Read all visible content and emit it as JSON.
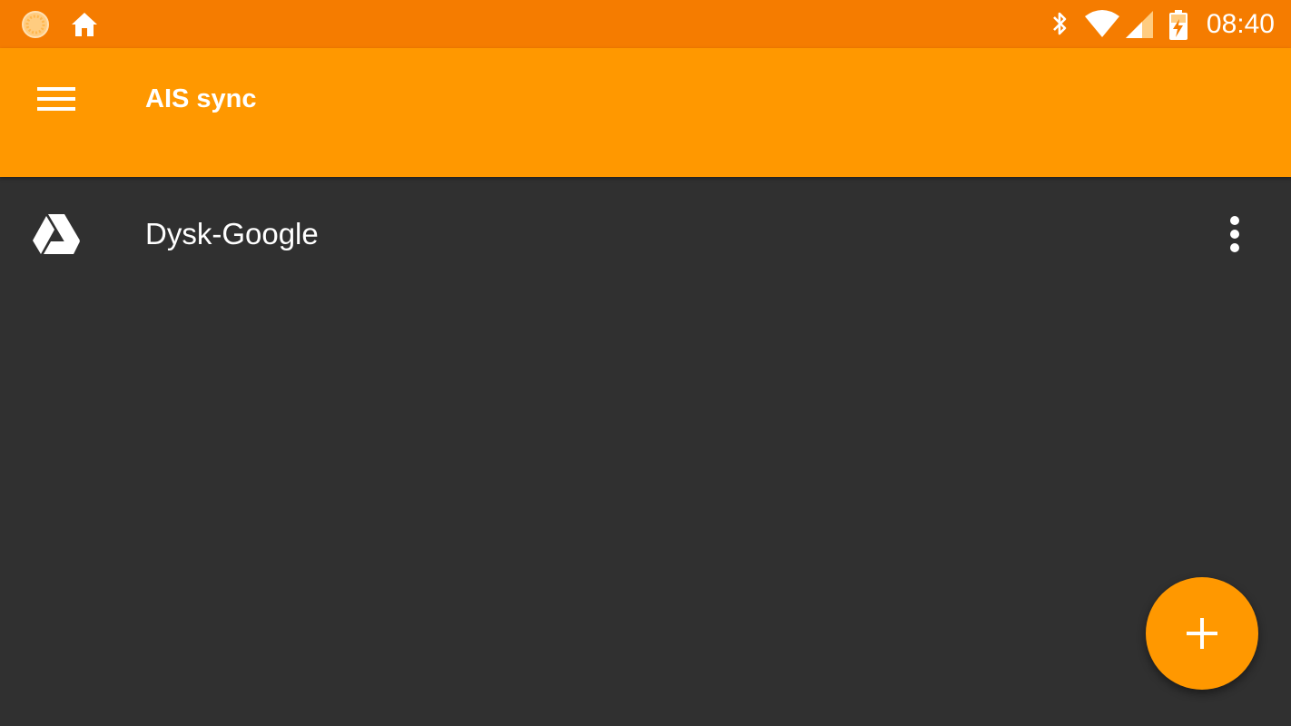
{
  "status_bar": {
    "time": "08:40",
    "left_icons": [
      "notification-app-icon",
      "home-icon"
    ],
    "right_icons": [
      "bluetooth-icon",
      "wifi-icon",
      "cell-signal-icon",
      "battery-charging-icon"
    ]
  },
  "app_bar": {
    "title": "AIS sync",
    "menu_icon": "hamburger-menu-icon"
  },
  "list": {
    "items": [
      {
        "label": "Dysk-Google",
        "icon": "google-drive-icon",
        "action_icon": "more-vert-icon"
      }
    ]
  },
  "fab": {
    "icon": "add-icon"
  },
  "colors": {
    "status_bar": "#f57c00",
    "app_bar": "#ff9800",
    "background": "#303030",
    "fab": "#ff9800",
    "text": "#ffffff"
  }
}
